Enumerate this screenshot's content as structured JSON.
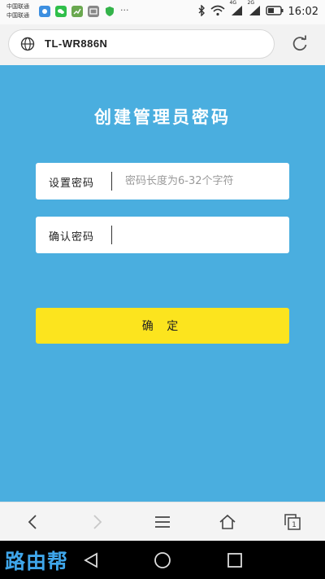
{
  "status_bar": {
    "carrier_1": "中国联通",
    "carrier_2": "中国联通",
    "network_4g": "4G",
    "network_2g": "2G",
    "time": "16:02",
    "more": "···",
    "icons": [
      "bluetooth-icon",
      "wifi-icon",
      "signal-icon",
      "battery-icon"
    ]
  },
  "browser": {
    "url": "TL-WR886N",
    "icons": [
      "globe-icon",
      "reload-icon"
    ]
  },
  "page": {
    "title": "创建管理员密码",
    "background_color": "#4aaedf",
    "fields": [
      {
        "label": "设置密码",
        "value": "",
        "placeholder": "密码长度为6-32个字符"
      },
      {
        "label": "确认密码",
        "value": "",
        "placeholder": ""
      }
    ],
    "confirm_button": "确 定",
    "button_color": "#fce41e"
  },
  "toolbar": {
    "icons": [
      "back-icon",
      "forward-icon",
      "menu-icon",
      "home-icon",
      "tabs-icon"
    ],
    "tab_count": "1"
  },
  "nav_bar": {
    "watermark": "路由帮",
    "icons": [
      "nav-back-icon",
      "nav-home-icon",
      "nav-recent-icon"
    ]
  }
}
